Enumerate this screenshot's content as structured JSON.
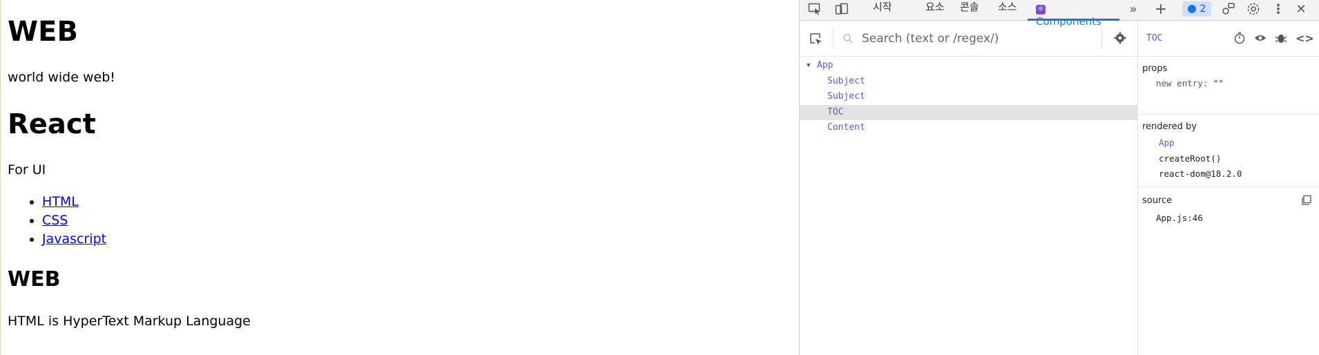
{
  "page": {
    "h1": "WEB",
    "p1": "world wide web!",
    "h1b": "React",
    "p2": "For UI",
    "links": [
      "HTML",
      "CSS",
      "Javascript"
    ],
    "h2": "WEB",
    "p3": "HTML is HyperText Markup Language"
  },
  "devtools": {
    "tabs": {
      "start": "시작",
      "elements": "요소",
      "console": "콘솔",
      "sources": "소스",
      "components": "Components"
    },
    "issues_count": "2",
    "search": {
      "placeholder": "Search (text or /regex/)"
    },
    "tree": {
      "root": "App",
      "children": [
        "Subject",
        "Subject",
        "TOC",
        "Content"
      ]
    },
    "detail": {
      "title": "TOC",
      "props_label": "props",
      "prop_key": "new entry",
      "prop_value": "\"\"",
      "rendered_by_label": "rendered by",
      "rendered_by": [
        "App",
        "createRoot()",
        "react-dom@18.2.0"
      ],
      "source_label": "source",
      "source_value": "App.js:46"
    },
    "colors": {
      "accent": "#1a73e8",
      "component": "#6a4fd1",
      "selected_row": "#e3e3e3"
    }
  }
}
